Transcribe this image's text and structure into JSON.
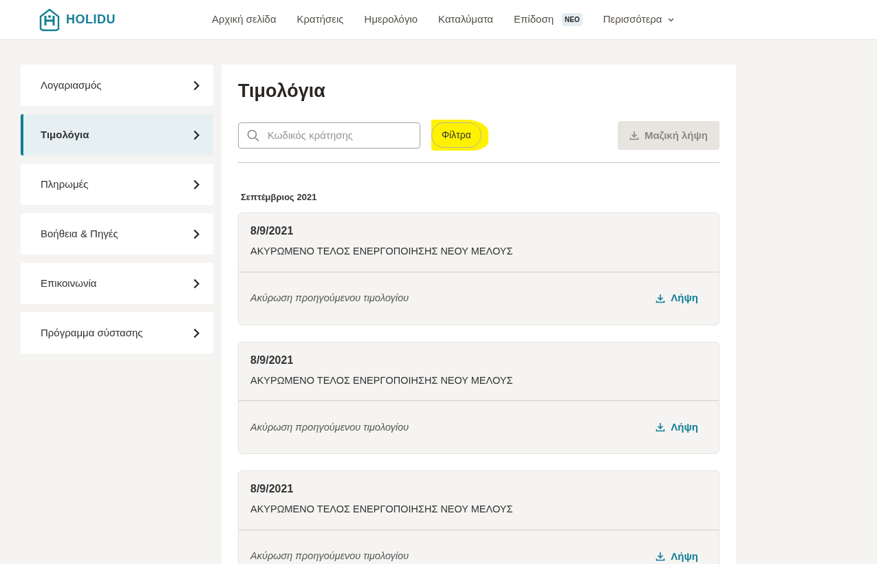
{
  "header": {
    "brand": "HOLIDU",
    "nav": [
      {
        "label": "Αρχική σελίδα"
      },
      {
        "label": "Κρατήσεις"
      },
      {
        "label": "Ημερολόγιο"
      },
      {
        "label": "Καταλύματα"
      },
      {
        "label": "Επίδοση",
        "badge": "NEO"
      },
      {
        "label": "Περισσότερα",
        "dropdown": true
      }
    ]
  },
  "sidebar": {
    "items": [
      {
        "label": "Λογαριασμός",
        "selected": false
      },
      {
        "label": "Τιμολόγια",
        "selected": true
      },
      {
        "label": "Πληρωμές",
        "selected": false
      },
      {
        "label": "Βοήθεια & Πηγές",
        "selected": false
      },
      {
        "label": "Επικοινωνία",
        "selected": false
      },
      {
        "label": "Πρόγραμμα σύστασης",
        "selected": false
      }
    ]
  },
  "main": {
    "title": "Τιμολόγια",
    "search": {
      "placeholder": "Κωδικός κράτησης"
    },
    "filters_button": {
      "label": "Φίλτρα",
      "highlighted": true
    },
    "bulk_download": {
      "label": "Μαζική λήψη",
      "disabled": true
    },
    "groups": [
      {
        "month": "Σεπτέμβριος 2021",
        "invoices": [
          {
            "date": "8/9/2021",
            "title": "ΑΚΥΡΩΜΕΝΟ ΤΕΛΟΣ ΕΝΕΡΓΟΠΟΙΗΣΗΣ ΝΕΟΥ ΜΕΛΟΥΣ",
            "note": "Ακύρωση προηγούμενου τιμολογίου",
            "action": "Λήψη"
          },
          {
            "date": "8/9/2021",
            "title": "ΑΚΥΡΩΜΕΝΟ ΤΕΛΟΣ ΕΝΕΡΓΟΠΟΙΗΣΗΣ ΝΕΟΥ ΜΕΛΟΥΣ",
            "note": "Ακύρωση προηγούμενου τιμολογίου",
            "action": "Λήψη"
          },
          {
            "date": "8/9/2021",
            "title": "ΑΚΥΡΩΜΕΝΟ ΤΕΛΟΣ ΕΝΕΡΓΟΠΟΙΗΣΗΣ ΝΕΟΥ ΜΕΛΟΥΣ",
            "note": "Ακύρωση προηγούμενου τιμολογίου",
            "action": "Λήψη"
          }
        ]
      }
    ]
  }
}
